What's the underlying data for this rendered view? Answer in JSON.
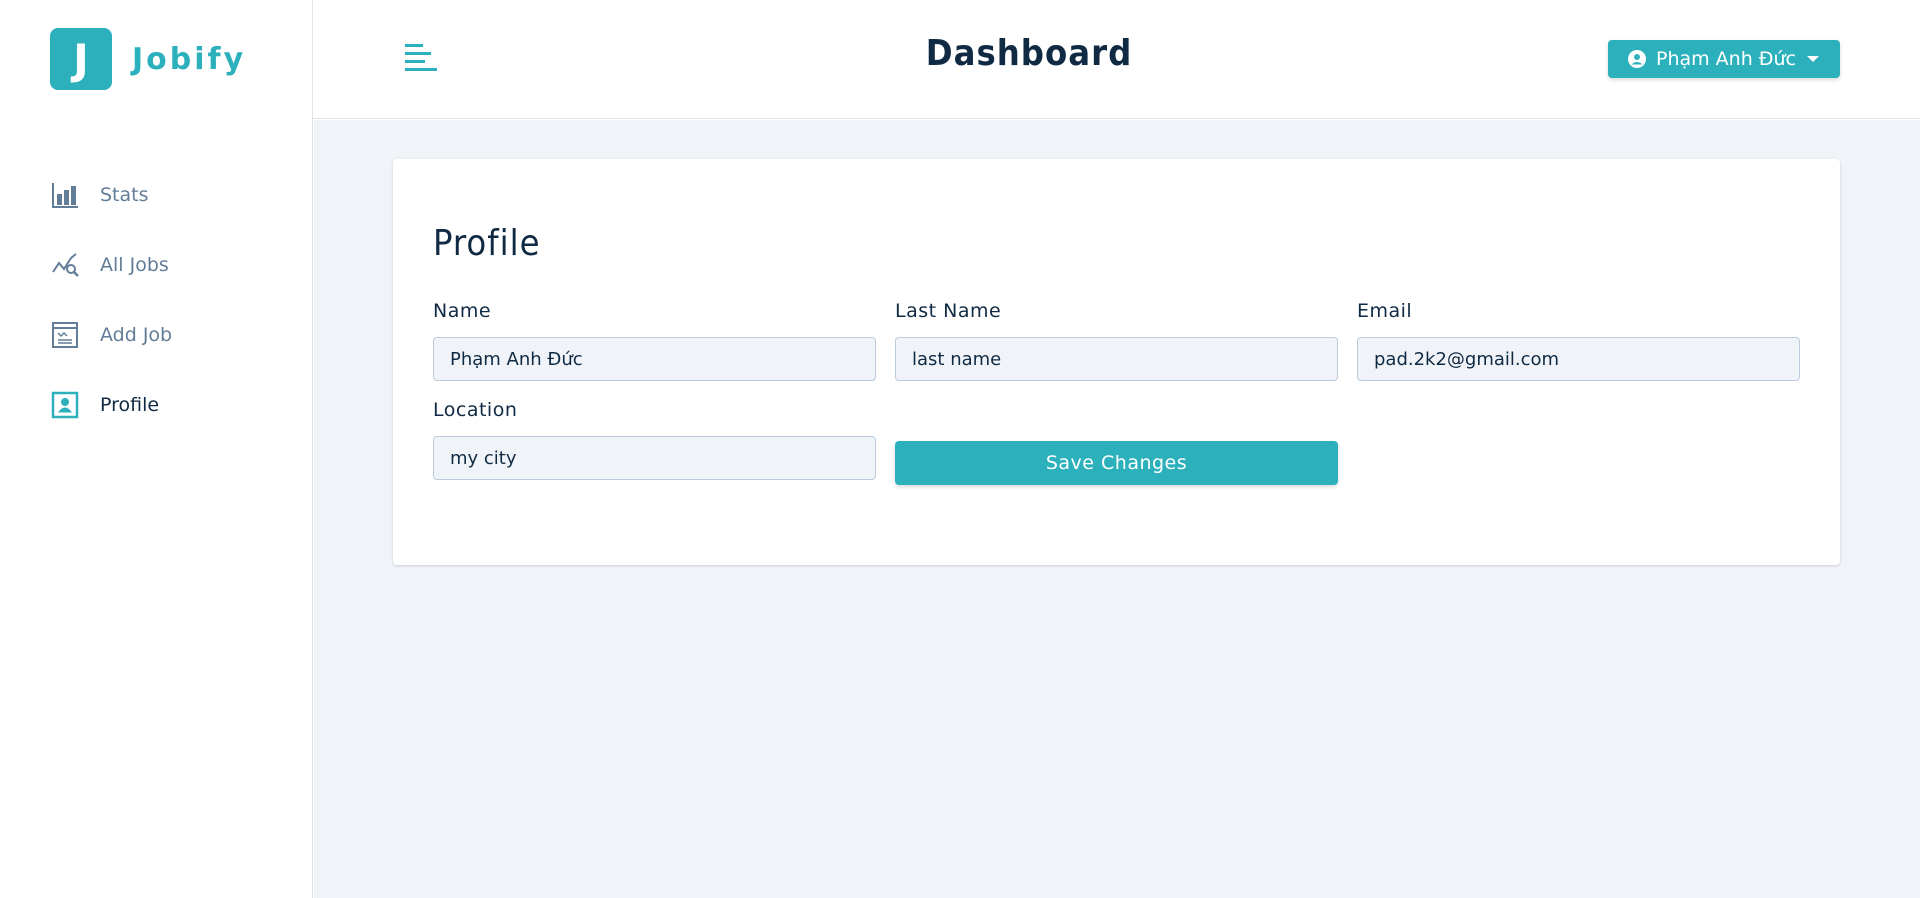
{
  "app": {
    "logo_letter": "J",
    "logo_text": "Jobify"
  },
  "sidebar": {
    "items": [
      {
        "label": "Stats",
        "icon": "bar-chart-icon",
        "active": false
      },
      {
        "label": "All Jobs",
        "icon": "search-chart-icon",
        "active": false
      },
      {
        "label": "Add Job",
        "icon": "form-icon",
        "active": false
      },
      {
        "label": "Profile",
        "icon": "profile-card-icon",
        "active": true
      }
    ]
  },
  "header": {
    "title": "Dashboard",
    "user_name": "Phạm Anh Đức"
  },
  "profile": {
    "title": "Profile",
    "fields": {
      "name": {
        "label": "Name",
        "value": "Phạm Anh Đức"
      },
      "last_name": {
        "label": "Last Name",
        "value": "last name"
      },
      "email": {
        "label": "Email",
        "value": "pad.2k2@gmail.com"
      },
      "location": {
        "label": "Location",
        "value": "my city"
      }
    },
    "save_label": "Save Changes"
  },
  "colors": {
    "primary": "#2cb1bc",
    "background": "#f0f4f8",
    "text": "#102a43",
    "muted": "#627d98"
  }
}
